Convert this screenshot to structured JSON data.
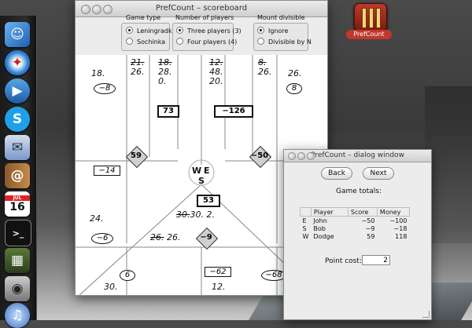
{
  "desktop": {
    "app_icon_label": "PrefCount",
    "dock_items": [
      "finder-icon",
      "safari-icon",
      "facetime-icon",
      "skype-icon",
      "mail-icon",
      "address-book-icon",
      "calendar-icon",
      "terminal-icon",
      "photo-icon",
      "iphoto-icon",
      "itunes-icon"
    ],
    "calendar_day": "16",
    "calendar_month": "JUL"
  },
  "scoreboard": {
    "title": "PrefCount – scoreboard",
    "game_type": {
      "title": "Game type",
      "options": [
        {
          "label": "Leningradka",
          "selected": true
        },
        {
          "label": "Sochinka",
          "selected": false
        }
      ]
    },
    "players": {
      "title": "Number of players",
      "options": [
        {
          "label": "Three players (3)",
          "selected": true
        },
        {
          "label": "Four players (4)",
          "selected": false
        }
      ]
    },
    "mount": {
      "title": "Mount divisible",
      "options": [
        {
          "label": "Ignore",
          "selected": true
        },
        {
          "label": "Divisible by N",
          "selected": false
        }
      ]
    },
    "compass": {
      "w": "W",
      "e": "E",
      "s": "S"
    },
    "west": {
      "col1": [
        "18.",
        "",
        ""
      ],
      "col1_struck": "21.",
      "col1_next": "26.",
      "col2_struck": "18.",
      "col2": [
        "28.",
        "0."
      ],
      "whist_oval": "−8",
      "box": "73",
      "neg_box": "−14",
      "diamond": "59"
    },
    "east": {
      "col1_struck": "12.",
      "col1": [
        "48.",
        "20."
      ],
      "col2_struck": "8.",
      "col2": [
        "26."
      ],
      "col3": [
        "26."
      ],
      "whist_oval": "8",
      "box": "−126",
      "diamond": "−50"
    },
    "south": {
      "box": "53",
      "mount_struck": "30.",
      "mount_rest": "30. 2.",
      "pool_struck": "26.",
      "pool_rest": "26.",
      "diamond": "−9",
      "neg_box": "−62",
      "left_val": "24.",
      "left_oval": "−6",
      "bottom_left_oval": "6",
      "bottom_left_val": "30.",
      "bottom_mid_val": "12.",
      "right_oval": "−68"
    }
  },
  "dialog": {
    "title": "PrefCount – dialog window",
    "back_label": "Back",
    "next_label": "Next",
    "game_totals_label": "Game totals:",
    "table_headers": [
      "",
      "Player",
      "Score",
      "Money"
    ],
    "rows": [
      {
        "seat": "E",
        "player": "John",
        "score": "−50",
        "money": "−100"
      },
      {
        "seat": "S",
        "player": "Bob",
        "score": "−9",
        "money": "−18"
      },
      {
        "seat": "W",
        "player": "Dodge",
        "score": "59",
        "money": "118"
      }
    ],
    "point_cost_label": "Point cost:",
    "point_cost_value": "2"
  }
}
